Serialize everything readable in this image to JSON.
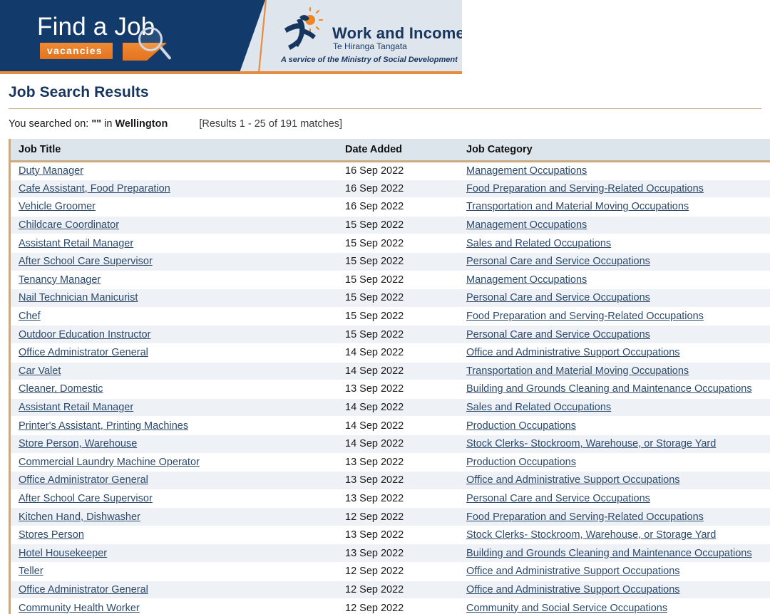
{
  "banner": {
    "find_a_job": {
      "title": "Find a Job",
      "badge": "vacancies",
      "magnifier_icon": "magnifying-glass-icon"
    },
    "work_and_income": {
      "title": "Work and Income",
      "subtitle": "Te Hiranga Tangata",
      "footer": "A service of the Ministry of Social Development",
      "logo_icon": "running-figure-sun-logo"
    }
  },
  "page": {
    "title": "Job Search Results",
    "searched_prefix": "You searched on:",
    "searched_term": "\"\"",
    "searched_in": "in",
    "searched_location": "Wellington",
    "results_count": "[Results 1 - 25 of 191 matches]"
  },
  "table": {
    "columns": [
      "Job Title",
      "Date Added",
      "Job Category"
    ],
    "rows": [
      {
        "title": "Duty Manager",
        "date": "16 Sep 2022",
        "category": "Management Occupations"
      },
      {
        "title": "Cafe Assistant, Food Preparation",
        "date": "16 Sep 2022",
        "category": "Food Preparation and Serving-Related Occupations"
      },
      {
        "title": "Vehicle Groomer",
        "date": "16 Sep 2022",
        "category": "Transportation and Material Moving Occupations"
      },
      {
        "title": "Childcare Coordinator",
        "date": "15 Sep 2022",
        "category": "Management Occupations"
      },
      {
        "title": "Assistant Retail Manager",
        "date": "15 Sep 2022",
        "category": "Sales and Related Occupations"
      },
      {
        "title": "After School Care Supervisor",
        "date": "15 Sep 2022",
        "category": "Personal Care and Service Occupations"
      },
      {
        "title": "Tenancy Manager",
        "date": "15 Sep 2022",
        "category": "Management Occupations"
      },
      {
        "title": "Nail Technician Manicurist",
        "date": "15 Sep 2022",
        "category": "Personal Care and Service Occupations"
      },
      {
        "title": "Chef",
        "date": "15 Sep 2022",
        "category": "Food Preparation and Serving-Related Occupations"
      },
      {
        "title": "Outdoor Education Instructor",
        "date": "15 Sep 2022",
        "category": "Personal Care and Service Occupations"
      },
      {
        "title": "Office Administrator General",
        "date": "14 Sep 2022",
        "category": "Office and Administrative Support Occupations"
      },
      {
        "title": "Car Valet",
        "date": "14 Sep 2022",
        "category": "Transportation and Material Moving Occupations"
      },
      {
        "title": "Cleaner, Domestic",
        "date": "13 Sep 2022",
        "category": "Building and Grounds Cleaning and Maintenance Occupations"
      },
      {
        "title": "Assistant Retail Manager",
        "date": "14 Sep 2022",
        "category": "Sales and Related Occupations"
      },
      {
        "title": "Printer's Assistant, Printing Machines",
        "date": "14 Sep 2022",
        "category": "Production Occupations"
      },
      {
        "title": "Store Person, Warehouse",
        "date": "14 Sep 2022",
        "category": "Stock Clerks- Stockroom, Warehouse, or Storage Yard"
      },
      {
        "title": "Commercial Laundry Machine Operator",
        "date": "13 Sep 2022",
        "category": "Production Occupations"
      },
      {
        "title": "Office Administrator General",
        "date": "13 Sep 2022",
        "category": "Office and Administrative Support Occupations"
      },
      {
        "title": "After School Care Supervisor",
        "date": "13 Sep 2022",
        "category": "Personal Care and Service Occupations"
      },
      {
        "title": "Kitchen Hand, Dishwasher",
        "date": "12 Sep 2022",
        "category": "Food Preparation and Serving-Related Occupations"
      },
      {
        "title": "Stores Person",
        "date": "13 Sep 2022",
        "category": "Stock Clerks- Stockroom, Warehouse, or Storage Yard"
      },
      {
        "title": "Hotel Housekeeper",
        "date": "13 Sep 2022",
        "category": "Building and Grounds Cleaning and Maintenance Occupations"
      },
      {
        "title": "Teller",
        "date": "12 Sep 2022",
        "category": "Office and Administrative Support Occupations"
      },
      {
        "title": "Office Administrator General",
        "date": "12 Sep 2022",
        "category": "Office and Administrative Support Occupations"
      },
      {
        "title": "Community Health Worker",
        "date": "12 Sep 2022",
        "category": "Community and Social Service Occupations"
      }
    ]
  },
  "colors": {
    "navy": "#123a6b",
    "orange": "#e98b3f",
    "tan_rule": "#c8ab82",
    "header_bg": "#dde5ec",
    "row_alt": "#eef1f5",
    "link": "#2d4a6b",
    "heading": "#16355f"
  }
}
